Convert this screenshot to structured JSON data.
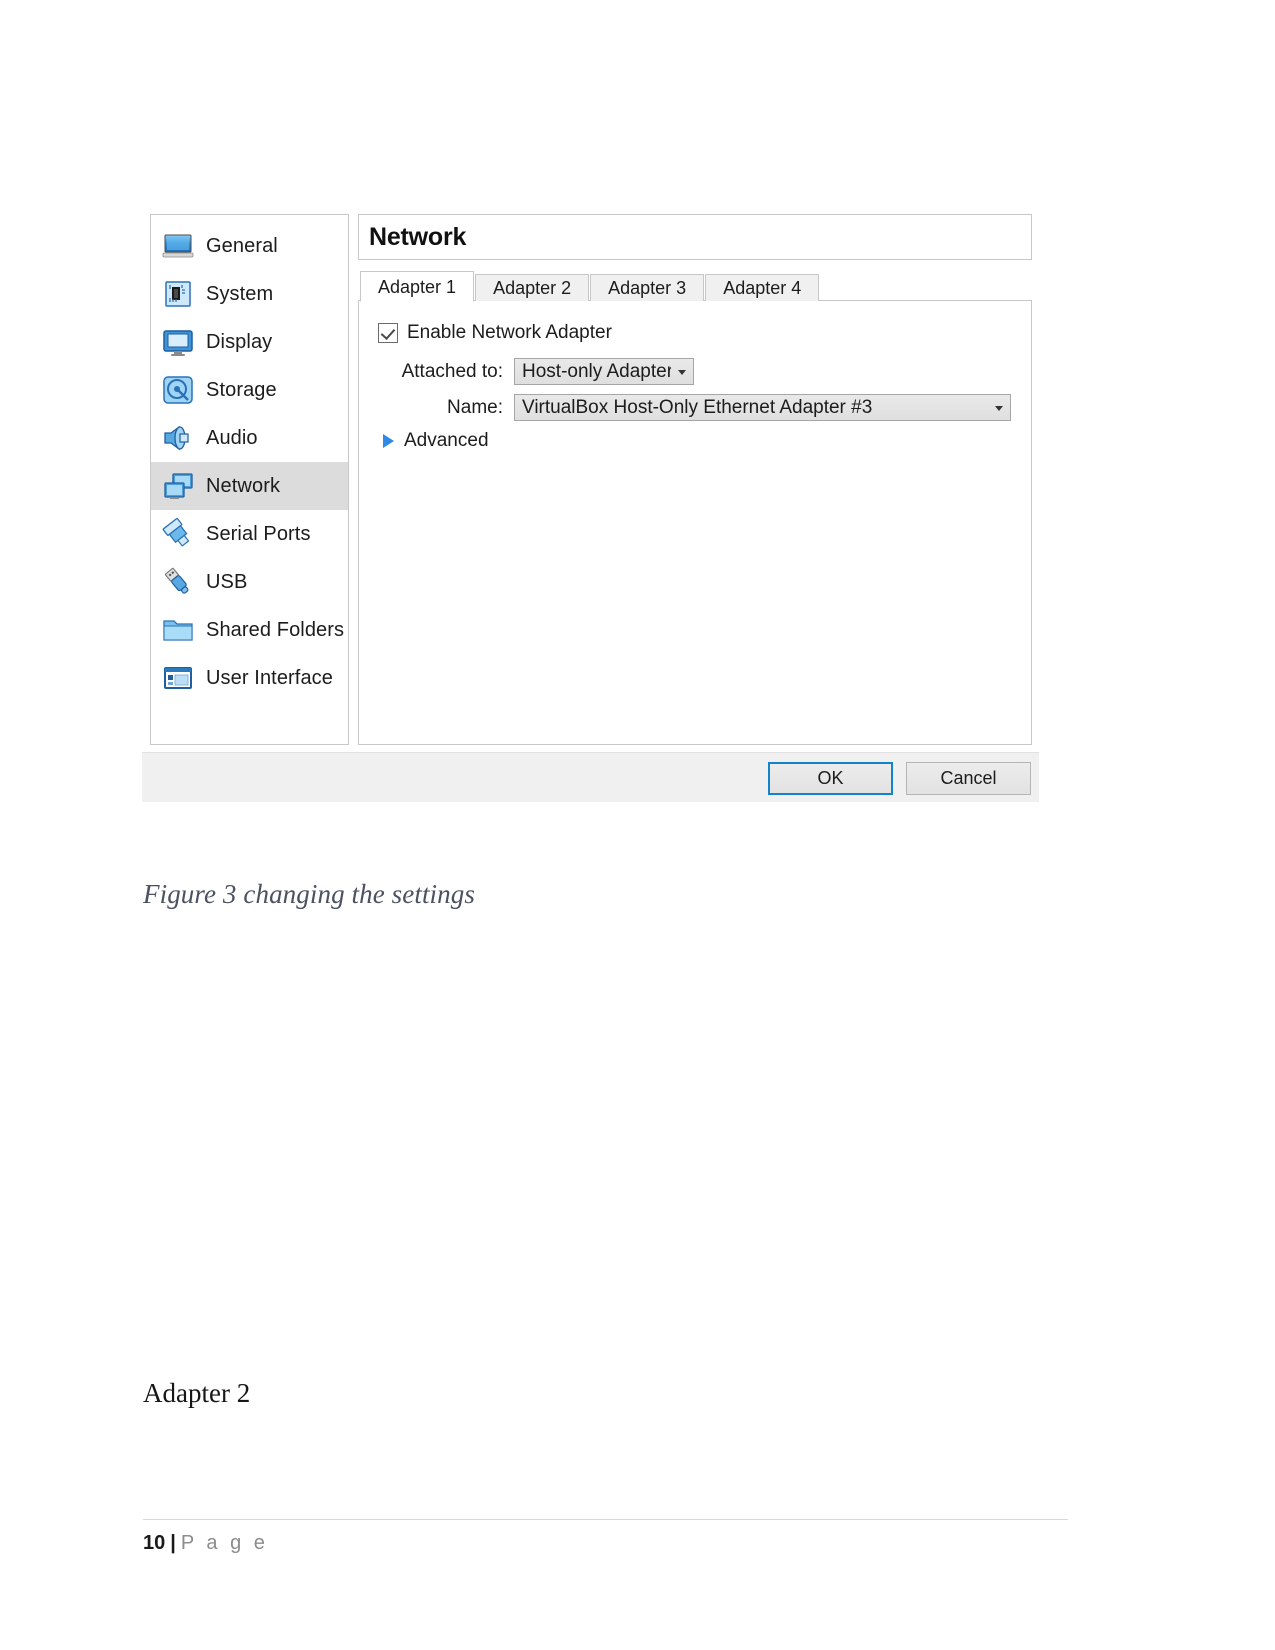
{
  "dialog": {
    "sidebar": {
      "items": [
        {
          "label": "General",
          "icon": "monitor-icon",
          "selected": false
        },
        {
          "label": "System",
          "icon": "motherboard-icon",
          "selected": false
        },
        {
          "label": "Display",
          "icon": "display-icon",
          "selected": false
        },
        {
          "label": "Storage",
          "icon": "harddisk-icon",
          "selected": false
        },
        {
          "label": "Audio",
          "icon": "speaker-icon",
          "selected": false
        },
        {
          "label": "Network",
          "icon": "network-icon",
          "selected": true
        },
        {
          "label": "Serial Ports",
          "icon": "serial-port-icon",
          "selected": false
        },
        {
          "label": "USB",
          "icon": "usb-icon",
          "selected": false
        },
        {
          "label": "Shared Folders",
          "icon": "folder-icon",
          "selected": false
        },
        {
          "label": "User Interface",
          "icon": "window-icon",
          "selected": false
        }
      ]
    },
    "pane": {
      "title": "Network",
      "tabs": [
        {
          "label": "Adapter 1",
          "active": true
        },
        {
          "label": "Adapter 2",
          "active": false
        },
        {
          "label": "Adapter 3",
          "active": false
        },
        {
          "label": "Adapter 4",
          "active": false
        }
      ],
      "enable_adapter": {
        "label": "Enable Network Adapter",
        "checked": true
      },
      "attached_to": {
        "label": "Attached to:",
        "value": "Host-only Adapter"
      },
      "name": {
        "label": "Name:",
        "value": "VirtualBox Host-Only Ethernet Adapter #3"
      },
      "advanced": {
        "label": "Advanced",
        "expanded": false
      }
    },
    "buttons": {
      "ok": "OK",
      "cancel": "Cancel"
    },
    "colors": {
      "focus_border": "#1484c8",
      "selection_bg": "#dcdcdc",
      "expander_blue": "#2e8ae6"
    }
  },
  "document": {
    "caption": "Figure 3 changing the settings",
    "heading": "Adapter 2",
    "footer": {
      "page_number": "10",
      "separator": "|",
      "page_word": "P a g e"
    }
  }
}
